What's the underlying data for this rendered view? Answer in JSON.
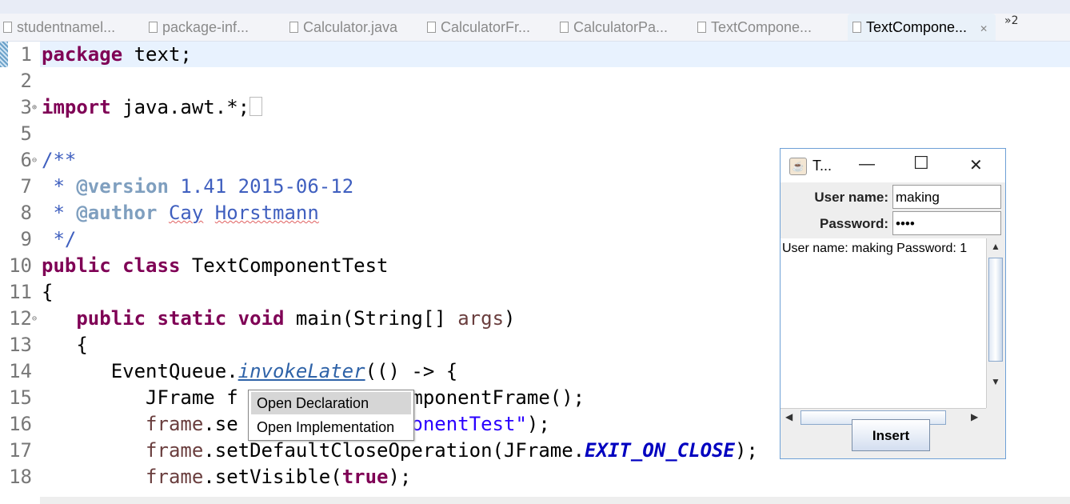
{
  "tabs": [
    {
      "label": "studentnamel...",
      "active": false
    },
    {
      "label": "package-inf...",
      "active": false
    },
    {
      "label": "Calculator.java",
      "active": false
    },
    {
      "label": "CalculatorFr...",
      "active": false
    },
    {
      "label": "CalculatorPa...",
      "active": false
    },
    {
      "label": "TextCompone...",
      "active": false
    },
    {
      "label": "TextCompone...",
      "active": true
    }
  ],
  "tab_overflow": "»2",
  "editor": {
    "lines": [
      {
        "n": "1",
        "fold": "",
        "tokens": [
          [
            "package",
            "kw"
          ],
          [
            " text;",
            ""
          ]
        ]
      },
      {
        "n": "2",
        "fold": "",
        "tokens": []
      },
      {
        "n": "3",
        "fold": "⊕",
        "tokens": [
          [
            "import",
            "kw"
          ],
          [
            " java.awt.*;",
            ""
          ]
        ],
        "collapsed": true
      },
      {
        "n": "5",
        "fold": "",
        "tokens": []
      },
      {
        "n": "6",
        "fold": "⊖",
        "tokens": [
          [
            "/**",
            "doc"
          ]
        ]
      },
      {
        "n": "7",
        "fold": "",
        "tokens": [
          [
            " * ",
            "doc"
          ],
          [
            "@version",
            "tag"
          ],
          [
            " 1.41 2015-06-12",
            "doc"
          ]
        ]
      },
      {
        "n": "8",
        "fold": "",
        "tokens": [
          [
            " * ",
            "doc"
          ],
          [
            "@author",
            "tag"
          ],
          [
            " ",
            "doc"
          ],
          [
            "Cay",
            "doc sp"
          ],
          [
            " ",
            "doc"
          ],
          [
            "Horstmann",
            "doc sp"
          ]
        ]
      },
      {
        "n": "9",
        "fold": "",
        "tokens": [
          [
            " */",
            "doc"
          ]
        ]
      },
      {
        "n": "10",
        "fold": "",
        "tokens": [
          [
            "public",
            "kw"
          ],
          [
            " ",
            ""
          ],
          [
            "class",
            "kw"
          ],
          [
            " TextComponentTest",
            ""
          ]
        ]
      },
      {
        "n": "11",
        "fold": "",
        "tokens": [
          [
            "{",
            ""
          ]
        ]
      },
      {
        "n": "12",
        "fold": "⊖",
        "tokens": [
          [
            "   ",
            ""
          ],
          [
            "public",
            "kw"
          ],
          [
            " ",
            ""
          ],
          [
            "static",
            "kw"
          ],
          [
            " ",
            ""
          ],
          [
            "void",
            "kw"
          ],
          [
            " main(String[] ",
            ""
          ],
          [
            "args",
            "var"
          ],
          [
            ")",
            ""
          ]
        ]
      },
      {
        "n": "13",
        "fold": "",
        "tokens": [
          [
            "   {",
            ""
          ]
        ]
      },
      {
        "n": "14",
        "fold": "",
        "tokens": [
          [
            "      EventQueue.",
            ""
          ],
          [
            "invokeLater",
            "link"
          ],
          [
            "(() -> {",
            ""
          ]
        ]
      },
      {
        "n": "15",
        "fold": "",
        "tokens": [
          [
            "         JFrame f",
            ""
          ],
          [
            "            ",
            ""
          ],
          [
            "tComponentFrame();",
            ""
          ]
        ]
      },
      {
        "n": "16",
        "fold": "",
        "tokens": [
          [
            "         ",
            ""
          ],
          [
            "frame",
            "var"
          ],
          [
            ".se",
            ""
          ],
          [
            "             ",
            ""
          ],
          [
            "mponentTest\"",
            "str"
          ],
          [
            ");",
            ""
          ]
        ]
      },
      {
        "n": "17",
        "fold": "",
        "tokens": [
          [
            "         ",
            ""
          ],
          [
            "frame",
            "var"
          ],
          [
            ".setDefaultCloseOperation(JFrame.",
            ""
          ],
          [
            "EXIT_ON_CLOSE",
            "sf"
          ],
          [
            ");",
            ""
          ]
        ]
      },
      {
        "n": "18",
        "fold": "",
        "tokens": [
          [
            "         ",
            ""
          ],
          [
            "frame",
            "var"
          ],
          [
            ".setVisible(",
            ""
          ],
          [
            "true",
            "kw"
          ],
          [
            ");",
            ""
          ]
        ]
      }
    ]
  },
  "context_menu": {
    "items": [
      {
        "label": "Open Declaration",
        "selected": true
      },
      {
        "label": "Open Implementation",
        "selected": false
      }
    ]
  },
  "dialog": {
    "title": "T...",
    "username_label": "User name:",
    "username_value": "making",
    "password_label": "Password:",
    "password_value": "••••",
    "textarea": "User name: making Password: 1",
    "insert_label": "Insert",
    "accent": "#6ea0d6"
  }
}
